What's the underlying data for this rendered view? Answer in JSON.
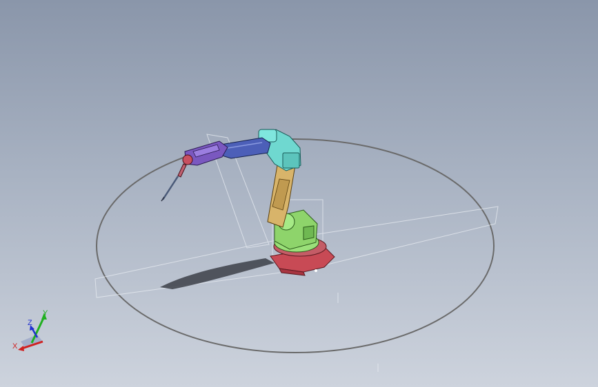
{
  "viewport": {
    "background_top": "#8a96aa",
    "background_bottom": "#cdd3dd"
  },
  "model": {
    "description_icon": "industrial-robot-arm-icon",
    "colors": {
      "base": "#c84a55",
      "turntable": "#9be07a",
      "lower_arm": "#d8b46a",
      "elbow": "#6fd8d0",
      "upper_arm": "#4c5fb8",
      "wrist": "#7a58c0",
      "torch": "#c85060",
      "workspace_ellipse": "#6a6a6a",
      "shadow": "#3c4048"
    }
  },
  "triad": {
    "x_label": "X",
    "y_label": "Y",
    "z_label": "Z",
    "x_color": "#d02020",
    "y_color": "#20b020",
    "z_color": "#2030d0"
  }
}
